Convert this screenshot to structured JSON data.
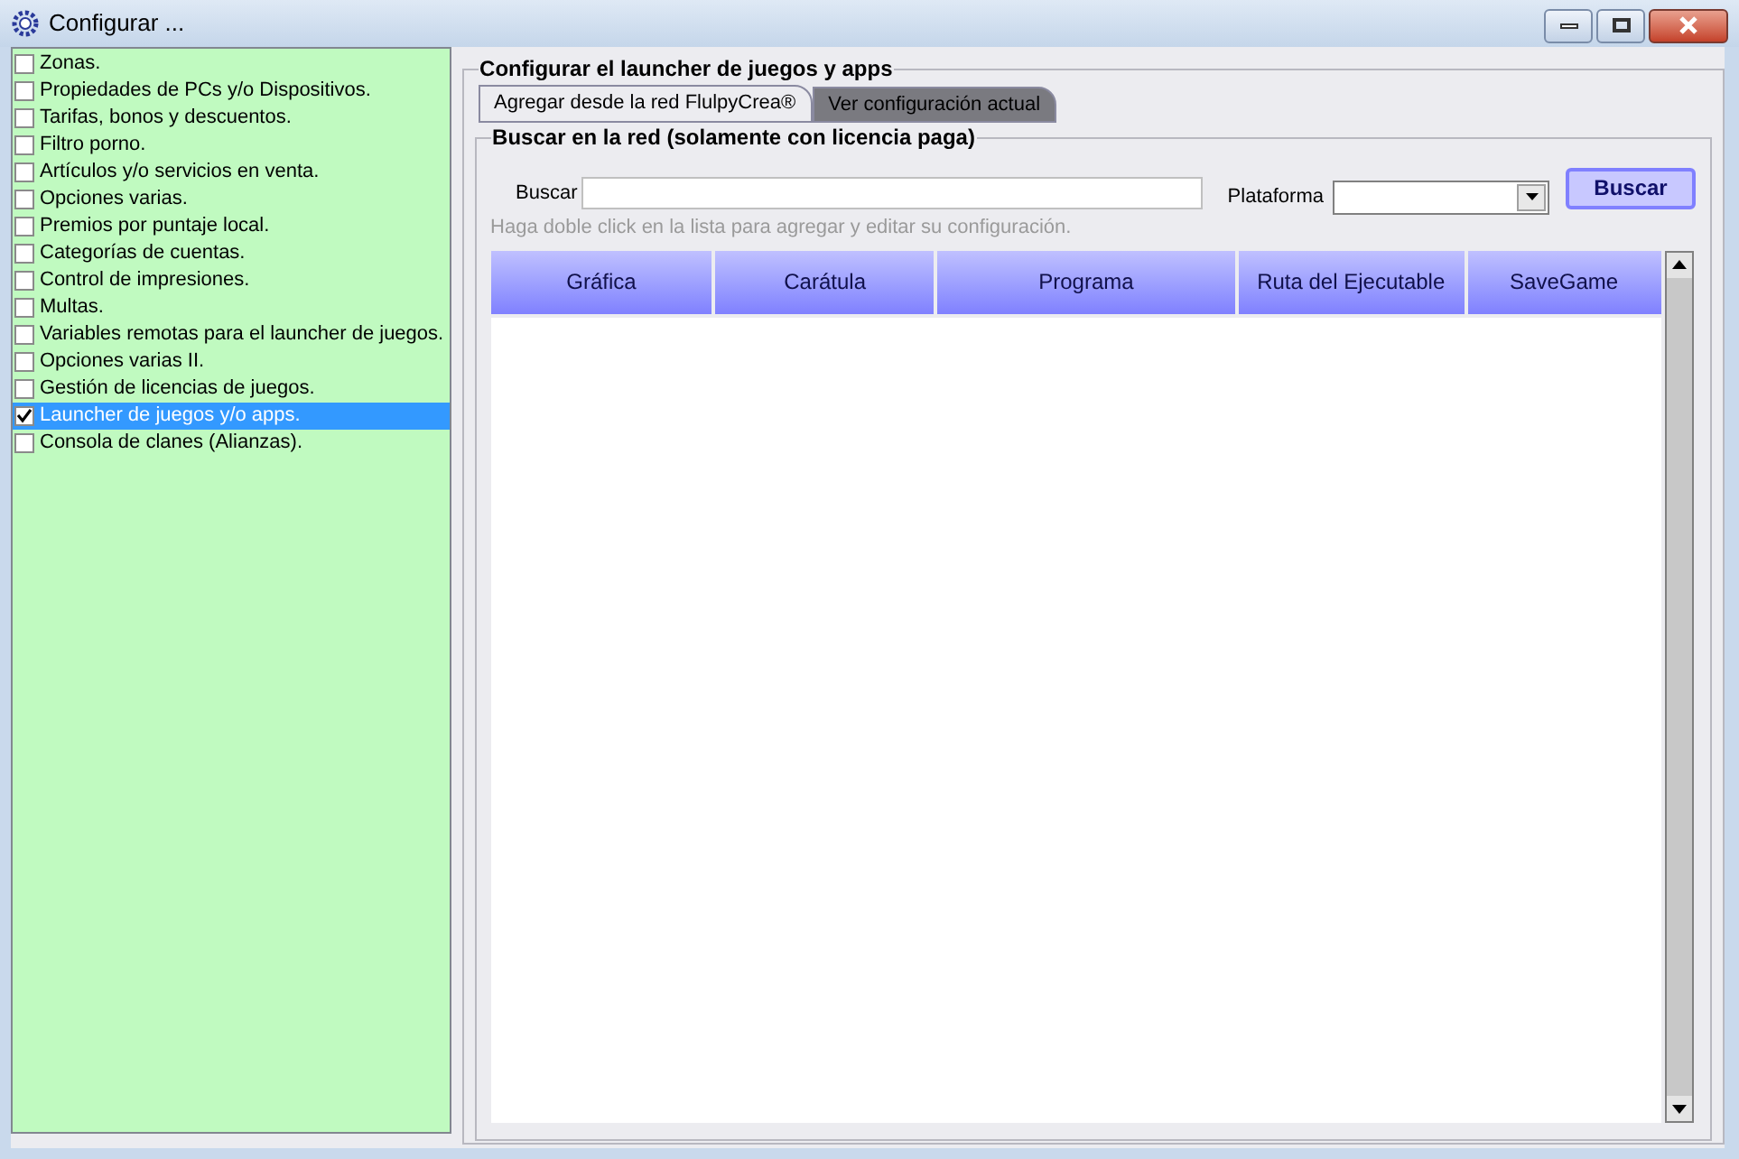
{
  "window": {
    "title": "Configurar ..."
  },
  "sidebar": {
    "items": [
      {
        "label": "Zonas.",
        "checked": false,
        "selected": false
      },
      {
        "label": "Propiedades de PCs y/o Dispositivos.",
        "checked": false,
        "selected": false
      },
      {
        "label": "Tarifas, bonos y descuentos.",
        "checked": false,
        "selected": false
      },
      {
        "label": "Filtro porno.",
        "checked": false,
        "selected": false
      },
      {
        "label": "Artículos y/o servicios en venta.",
        "checked": false,
        "selected": false
      },
      {
        "label": "Opciones varias.",
        "checked": false,
        "selected": false
      },
      {
        "label": "Premios por puntaje local.",
        "checked": false,
        "selected": false
      },
      {
        "label": "Categorías de cuentas.",
        "checked": false,
        "selected": false
      },
      {
        "label": "Control de impresiones.",
        "checked": false,
        "selected": false
      },
      {
        "label": "Multas.",
        "checked": false,
        "selected": false
      },
      {
        "label": "Variables remotas para el launcher de juegos.",
        "checked": false,
        "selected": false
      },
      {
        "label": "Opciones varias II.",
        "checked": false,
        "selected": false
      },
      {
        "label": "Gestión de licencias de juegos.",
        "checked": false,
        "selected": false
      },
      {
        "label": "Launcher de juegos y/o apps.",
        "checked": true,
        "selected": true
      },
      {
        "label": "Consola de clanes (Alianzas).",
        "checked": false,
        "selected": false
      }
    ]
  },
  "group": {
    "title": "Configurar el launcher de juegos y apps",
    "tabs": [
      {
        "label": "Agregar desde la red FlulpyCrea®",
        "selected": true
      },
      {
        "label": "Ver configuración actual",
        "selected": false
      }
    ],
    "search_group": {
      "title": "Buscar en la red (solamente con licencia paga)",
      "search_label": "Buscar",
      "platform_label": "Plataforma",
      "button": "Buscar",
      "hint": "Haga doble click en la lista para agregar y editar su configuración.",
      "columns": [
        "Gráfica",
        "Carátula",
        "Programa",
        "Ruta del Ejecutable",
        "SaveGame"
      ]
    }
  }
}
